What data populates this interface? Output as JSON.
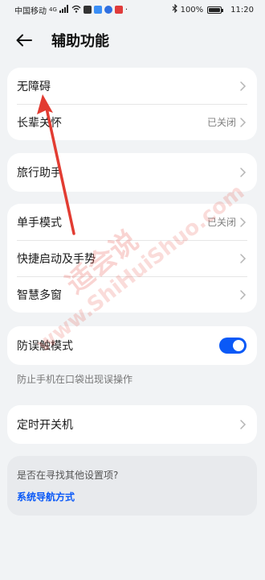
{
  "status_bar": {
    "carrier": "中国移动",
    "network": "4G",
    "battery": "100%",
    "time": "11:20"
  },
  "header": {
    "title": "辅助功能"
  },
  "groups": {
    "g1": [
      {
        "label": "无障碍",
        "value": ""
      },
      {
        "label": "长辈关怀",
        "value": "已关闭"
      }
    ],
    "g2": [
      {
        "label": "旅行助手",
        "value": ""
      }
    ],
    "g3": [
      {
        "label": "单手模式",
        "value": "已关闭"
      },
      {
        "label": "快捷启动及手势",
        "value": ""
      },
      {
        "label": "智慧多窗",
        "value": ""
      }
    ],
    "g4": {
      "label": "防误触模式",
      "enabled": true
    },
    "g5": [
      {
        "label": "定时开关机",
        "value": ""
      }
    ]
  },
  "hint": "防止手机在口袋出现误操作",
  "suggestion": {
    "title": "是否在寻找其他设置项?",
    "link": "系统导航方式"
  },
  "watermark": {
    "cn": "适会说",
    "en": "www.ShiHuiShuo.com"
  },
  "colors": {
    "accent": "#0a59f7",
    "background": "#f1f3f5",
    "annotation": "#e23c32"
  }
}
